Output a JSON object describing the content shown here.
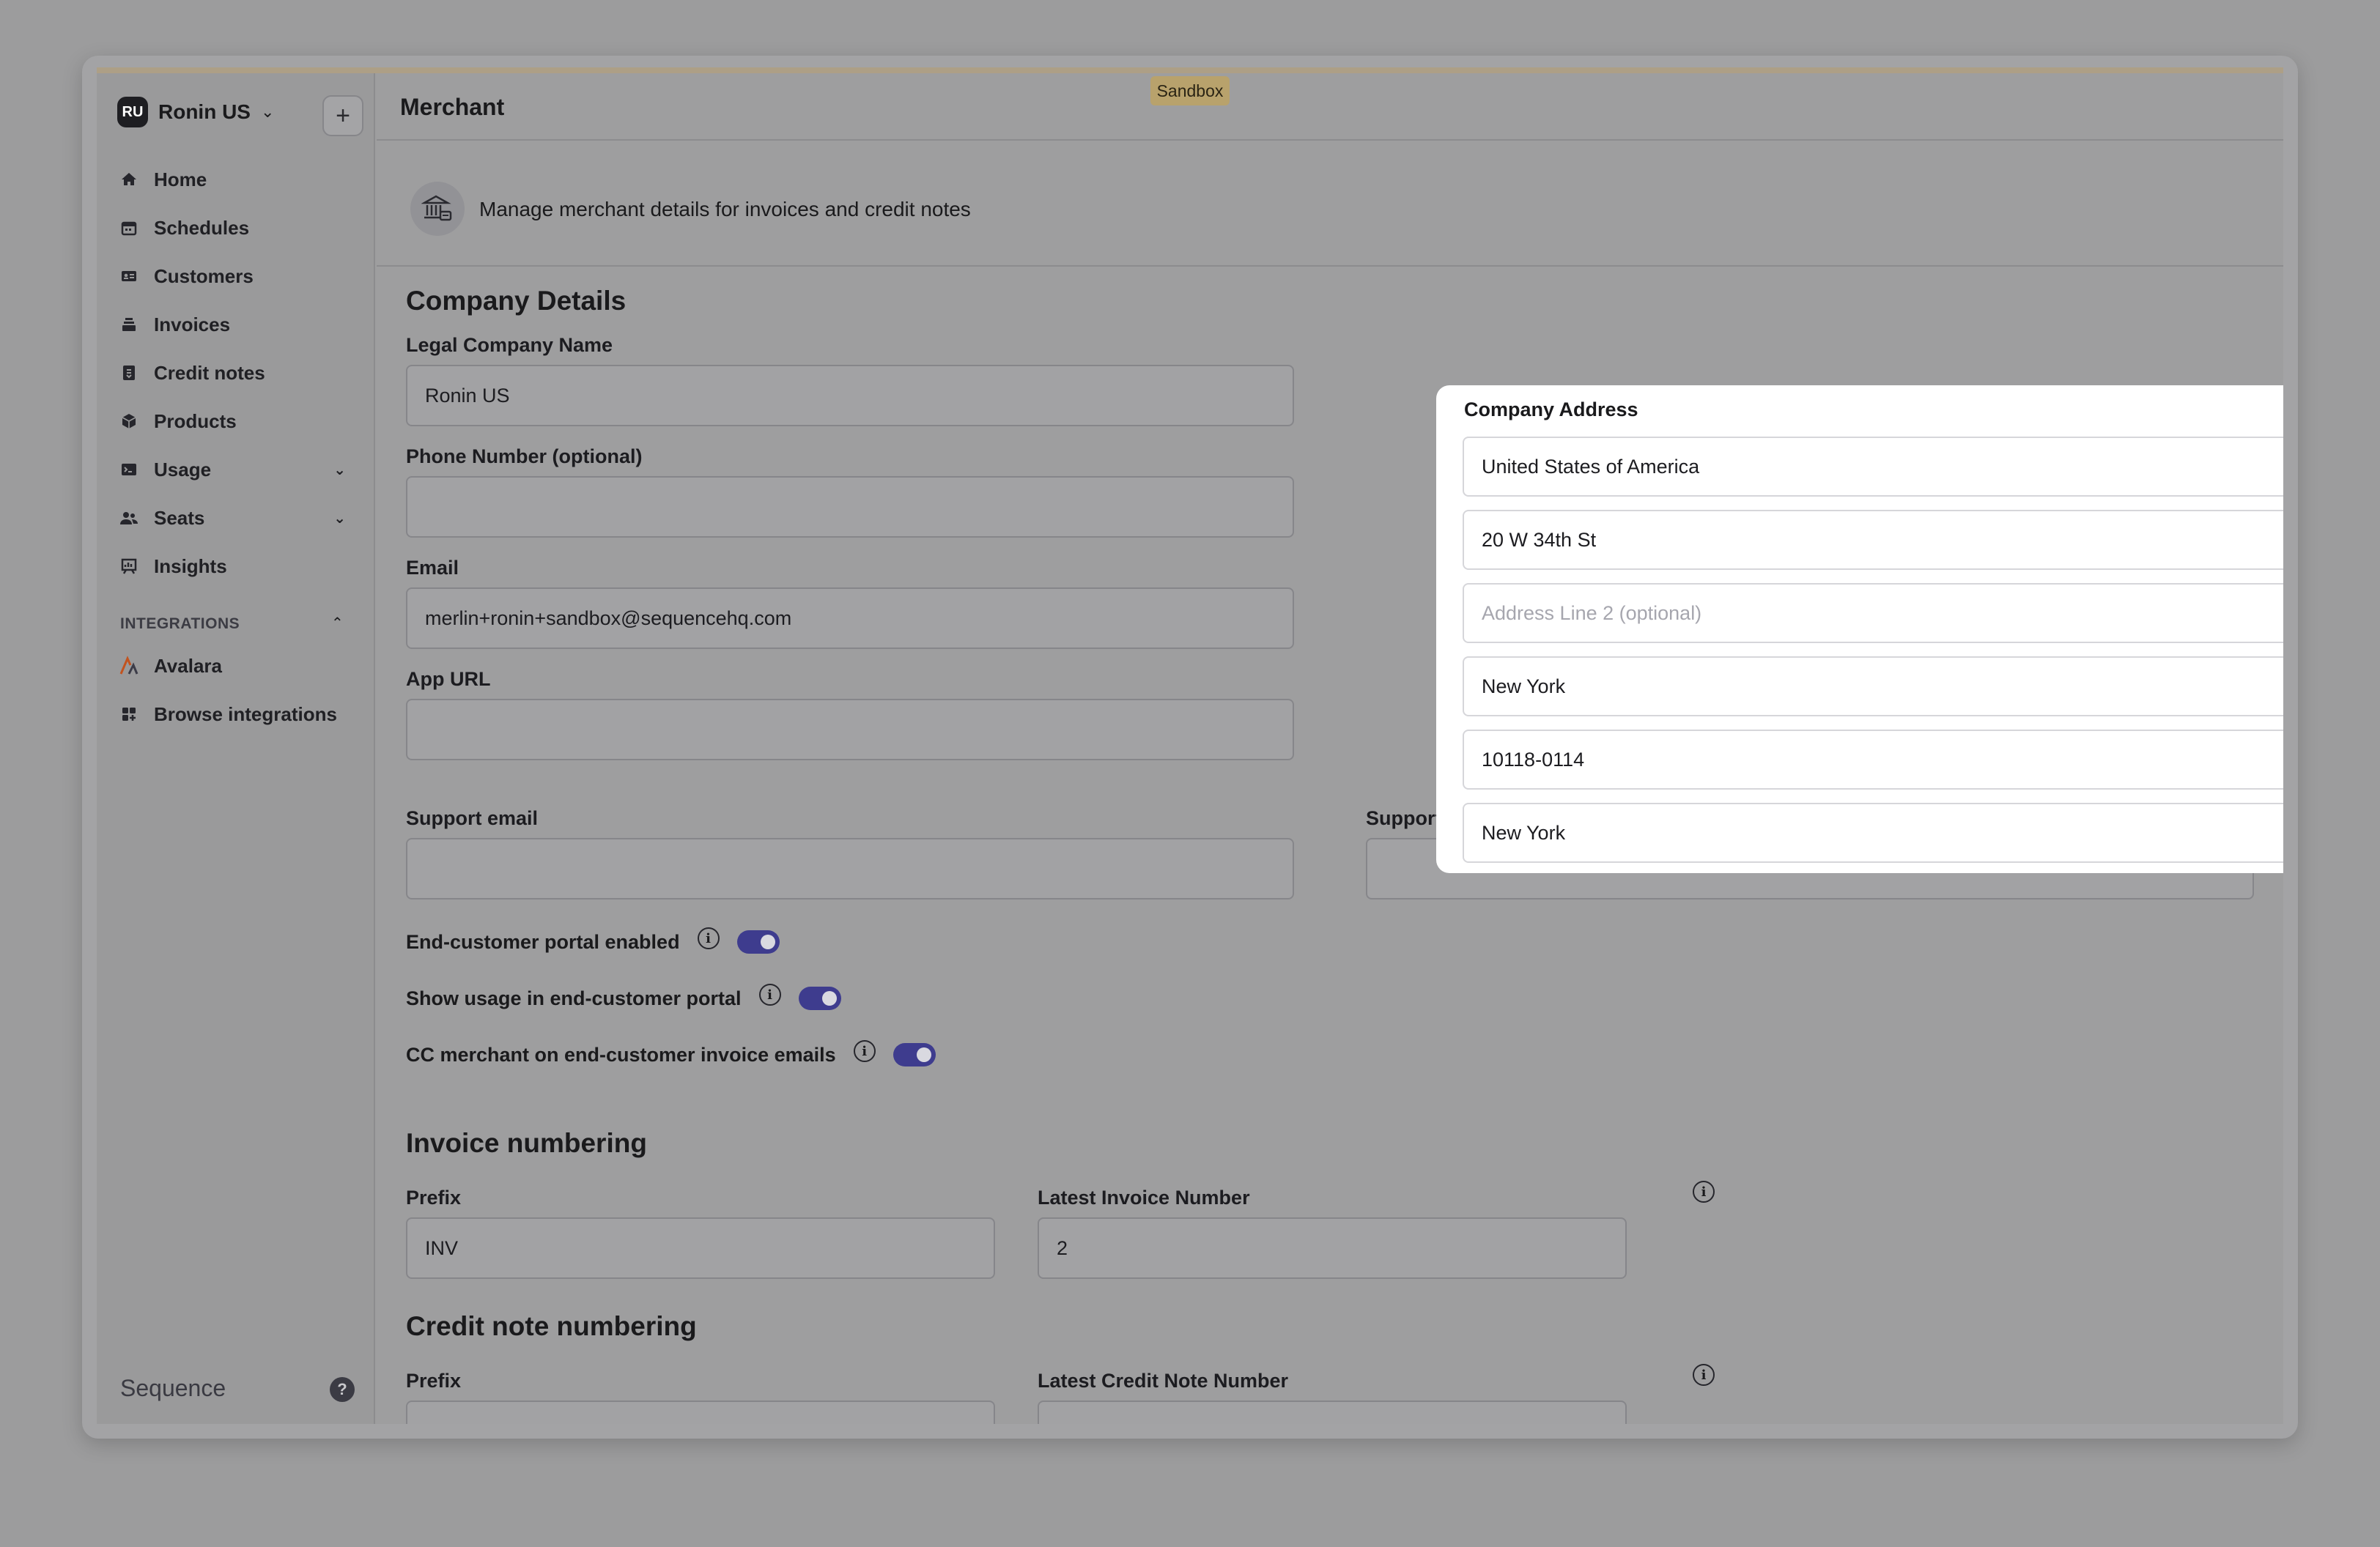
{
  "sandbox_label": "Sandbox",
  "sidebar": {
    "org_badge": "RU",
    "org_name": "Ronin US",
    "items": [
      {
        "label": "Home"
      },
      {
        "label": "Schedules"
      },
      {
        "label": "Customers"
      },
      {
        "label": "Invoices"
      },
      {
        "label": "Credit notes"
      },
      {
        "label": "Products"
      },
      {
        "label": "Usage"
      },
      {
        "label": "Seats"
      },
      {
        "label": "Insights"
      }
    ],
    "integrations_title": "INTEGRATIONS",
    "integrations": [
      {
        "label": "Avalara"
      },
      {
        "label": "Browse integrations"
      }
    ],
    "brand": "Sequence",
    "help": "?"
  },
  "header": {
    "title": "Merchant"
  },
  "banner": {
    "text": "Manage merchant details for invoices and credit notes"
  },
  "company": {
    "title": "Company Details",
    "legal_name_label": "Legal Company Name",
    "legal_name_value": "Ronin US",
    "phone_label": "Phone Number (optional)",
    "phone_value": "",
    "email_label": "Email",
    "email_value": "merlin+ronin+sandbox@sequencehq.com",
    "app_url_label": "App URL",
    "app_url_value": "",
    "support_email_label": "Support email",
    "support_email_value": "",
    "support_url_label": "Support URL",
    "support_url_value": ""
  },
  "address": {
    "title": "Company Address",
    "country": "United States of America",
    "line1": "20 W 34th St",
    "line2_placeholder": "Address Line 2 (optional)",
    "city": "New York",
    "postcode": "10118-0114",
    "state": "New York"
  },
  "toggles": [
    {
      "label": "End-customer portal enabled",
      "on": true
    },
    {
      "label": "Show usage in end-customer portal",
      "on": true
    },
    {
      "label": "CC merchant on end-customer invoice emails",
      "on": true
    }
  ],
  "invoice_numbering": {
    "title": "Invoice numbering",
    "prefix_label": "Prefix",
    "prefix_value": "INV",
    "latest_label": "Latest Invoice Number",
    "latest_value": "2"
  },
  "credit_note_numbering": {
    "title": "Credit note numbering",
    "prefix_label": "Prefix",
    "latest_label": "Latest Credit Note Number"
  },
  "colors": {
    "toggle_on": "#3e3c8e",
    "sandbox_badge": "#b8a26c"
  }
}
